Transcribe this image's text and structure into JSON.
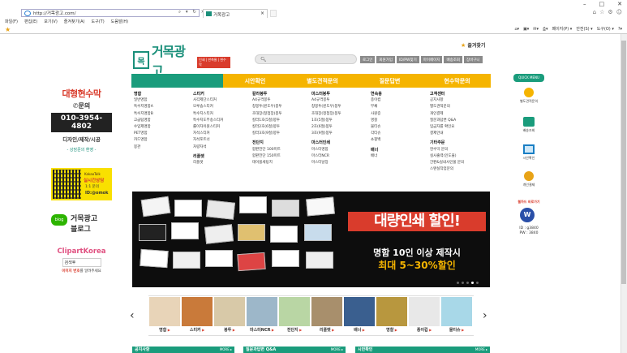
{
  "browser": {
    "url": "http://거목광고.com/",
    "tab_title": "거목광고",
    "menus": [
      "파일(F)",
      "편집(E)",
      "보기(V)",
      "즐겨찾기(A)",
      "도구(T)",
      "도움말(H)"
    ],
    "commands": [
      "페이지(P) ▾",
      "안전(S) ▾",
      "도구(O) ▾"
    ]
  },
  "header": {
    "logo_mark": "목",
    "logo_name": "거목광고",
    "logo_tag": "인쇄 | 판촉물 | 현수막",
    "bookmark_label": "즐겨찾기",
    "top_links": [
      "로그인",
      "회원가입",
      "ID/PW찾기",
      "마이페이지",
      "배송조회",
      "장바구니"
    ]
  },
  "nav": {
    "items": [
      "시안확인",
      "별도견적문의",
      "질문답변",
      "현수막문의"
    ]
  },
  "menu_columns": [
    {
      "title": "명함",
      "items": [
        "일반명함",
        "특수지명함A",
        "특수지명함B",
        "고급팀명함",
        "수입제명함",
        "PET명함",
        "카드명함",
        "봉관"
      ]
    },
    {
      "title": "스티커",
      "items": [
        "사각제단스티커",
        "모루솜스티커",
        "특수지스티커",
        "특수지도무송스티커",
        "롤이자이원스티커",
        "자석스티커",
        "자석포트너",
        "차량자석"
      ],
      "sub_title": "리플렛",
      "sub_items": [
        "리플렛"
      ]
    },
    {
      "title": "칼라봉투",
      "items": [
        "A4규격봉투",
        "창봉투(윈도우)봉투",
        "초대장(청첩장)봉투",
        "칼라1호(5절)봉투",
        "칼라2호(6절)봉투",
        "칼라3호(9절)봉투"
      ],
      "sub_title": "전단지",
      "sub_items": [
        "합판전단 100미트",
        "합판전단 150미트",
        "테이블세팅지"
      ]
    },
    {
      "title": "마스터봉투",
      "items": [
        "A4규격봉투",
        "창봉투(윈도우)봉투",
        "초대장(청첩장)봉투",
        "1호(5절)봉투",
        "2호(6절)봉투",
        "3호(9절)봉투"
      ],
      "sub_title": "마스터인쇄",
      "sub_items": [
        "마스터명함",
        "마스터NCR",
        "마스터날장"
      ]
    },
    {
      "title": "연속용",
      "items": [
        "종이컵",
        "부채",
        "사원증",
        "명찰",
        "물티슈",
        "각티슈",
        "쇼핑백"
      ],
      "sub_title": "배너",
      "sub_items": [
        "배너"
      ]
    },
    {
      "title": "고객센터",
      "items": [
        "공지사항",
        "별도견적문의",
        "개인결제",
        "질문과답변 Q&A",
        "입금자를 확인요",
        "결제안내"
      ],
      "sub_title": "기타주문",
      "sub_items": [
        "현수막 문의",
        "실사출력(인도물)",
        "간판&실내사인물 문의",
        "스탠실작업문의"
      ]
    }
  ],
  "left_banners": {
    "b1_title": "대형현수막",
    "b1_sub": "문의",
    "b1_phone": "010-3954-4802",
    "b1_desc": "디자인/제작/시공",
    "b1_note": "- 상담문의 환영 -",
    "kakao_brand": "KakaoTalk",
    "kakao_title": "실시간상담",
    "kakao_sub": "1:1 문의",
    "kakao_id": "ID:@omok",
    "blog_icon": "blog",
    "blog_line1": "거목광고",
    "blog_line2": "블로그",
    "clip_title": "ClipartKorea",
    "clip_search": "검색후",
    "clip_note_red": "이미지 번호",
    "clip_note": "를 알려주세요"
  },
  "banner": {
    "headline": "대량인쇄 할인!",
    "line2": "명함 10인 이상 제작시",
    "line3": "최대 5~30%할인",
    "slides": 5,
    "active_slide": 4
  },
  "products": [
    {
      "label": "명함",
      "color": "#e8d4b8"
    },
    {
      "label": "스티커",
      "color": "#c97a3a"
    },
    {
      "label": "봉투",
      "color": "#d8c9a8"
    },
    {
      "label": "마스터NCR",
      "color": "#9db7c9"
    },
    {
      "label": "전단지",
      "color": "#b9d6a4"
    },
    {
      "label": "리플렛",
      "color": "#a88f6c"
    },
    {
      "label": "배너",
      "color": "#3a5f8f"
    },
    {
      "label": "명찰",
      "color": "#b8973e"
    },
    {
      "label": "종이컵",
      "color": "#e8e8e8"
    },
    {
      "label": "물티슈",
      "color": "#a8d8e8"
    }
  ],
  "bottom_bars": [
    {
      "title": "공지사항",
      "more": "MORE ▸"
    },
    {
      "title": "질문과답변 Q&A",
      "more": "MORE ▸"
    },
    {
      "title": "시안확인",
      "more": "MORE ▸"
    }
  ],
  "quick_menu": {
    "title": "QUICK MENU",
    "items": [
      "별도견적문의",
      "배송조회",
      "시안확인",
      "개인결제"
    ],
    "webhard_title": "웹하드 바로가기",
    "webhard_id": "ID : g3840",
    "webhard_pw": "PW : 3840"
  },
  "colors": {
    "brand_green": "#1a9c7c",
    "nav_yellow": "#f5b400",
    "accent_red": "#d93c2c"
  }
}
